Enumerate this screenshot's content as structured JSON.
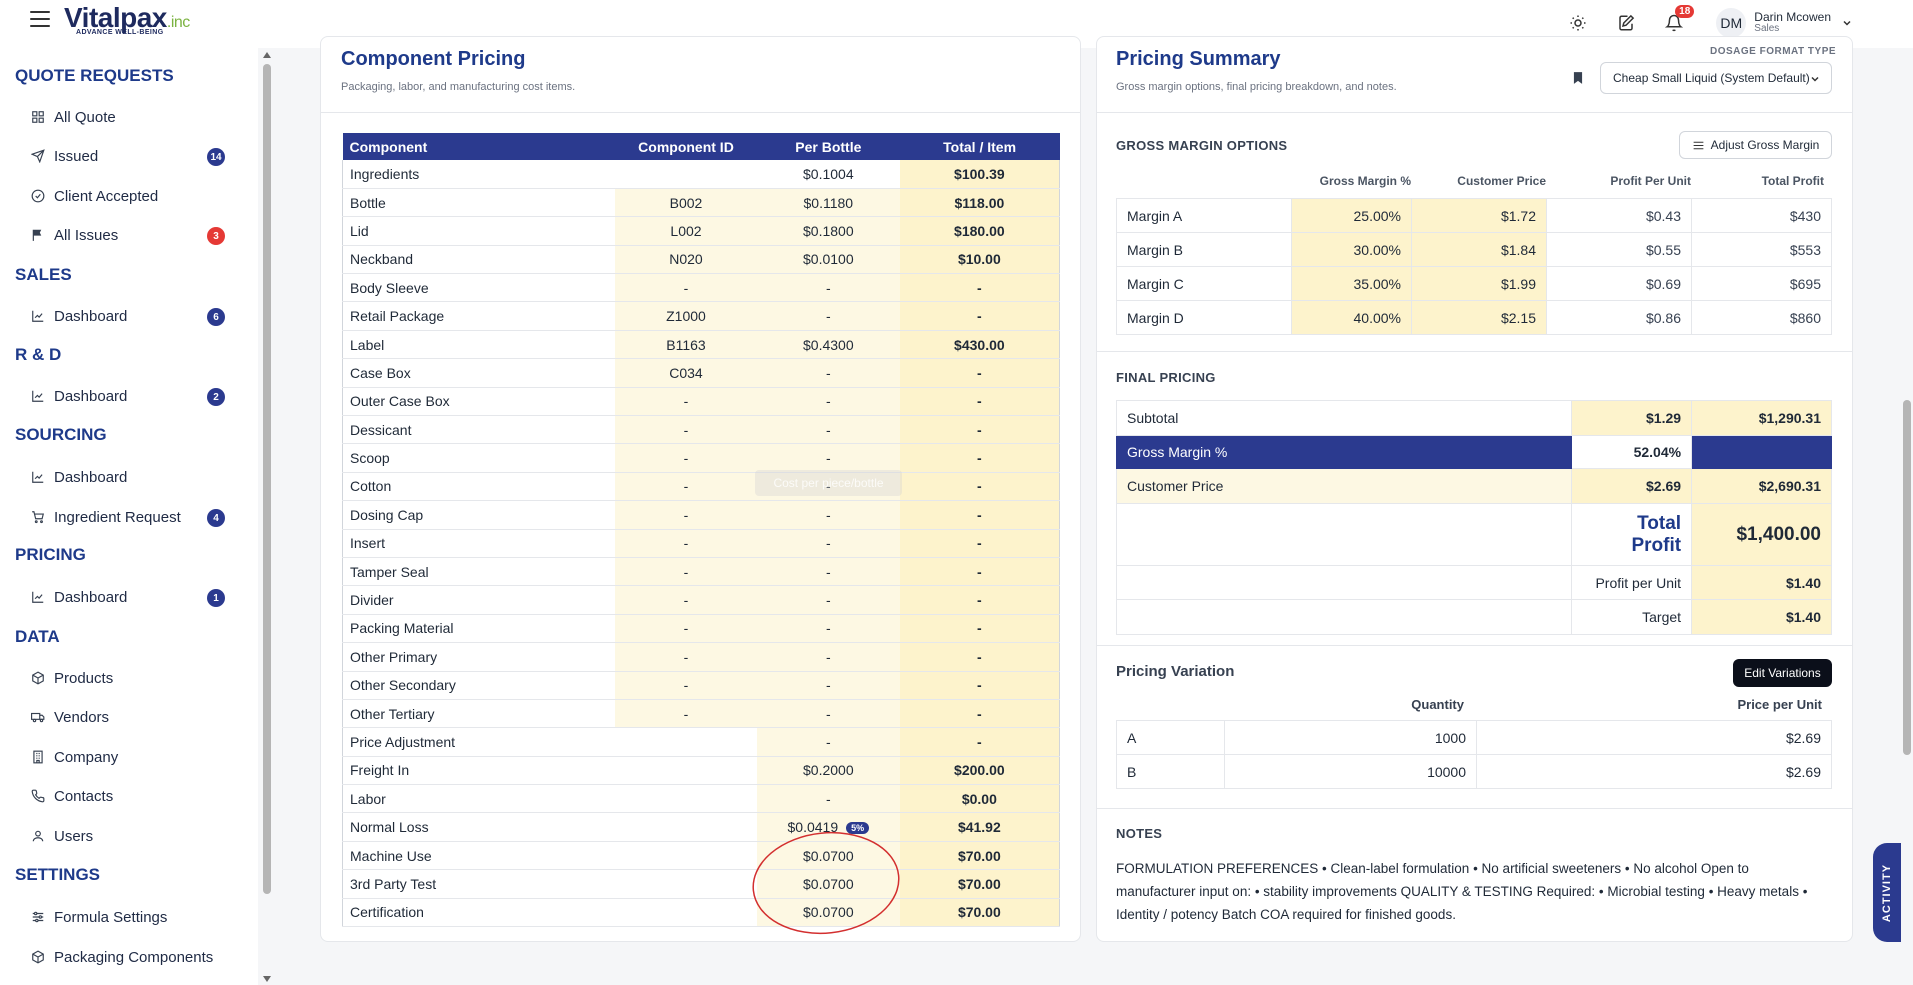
{
  "app": {
    "logo_name": "Vitalpax",
    "logo_suffix": ".inc",
    "logo_tagline": "ADVANCE WELL-BEING",
    "notifications_count": "18",
    "user_initials": "DM",
    "user_name": "Darin Mcowen",
    "user_role": "Sales"
  },
  "sidebar": {
    "sections": [
      {
        "title": "QUOTE REQUESTS",
        "items": [
          {
            "label": "All Quote",
            "icon": "grid-icon",
            "badge": ""
          },
          {
            "label": "Issued",
            "icon": "send-icon",
            "badge": "14"
          },
          {
            "label": "Client Accepted",
            "icon": "check-circle-icon",
            "badge": ""
          },
          {
            "label": "All Issues",
            "icon": "flag-icon",
            "badge": "3"
          }
        ]
      },
      {
        "title": "SALES",
        "items": [
          {
            "label": "Dashboard",
            "icon": "chart-icon",
            "badge": "6"
          }
        ]
      },
      {
        "title": "R & D",
        "items": [
          {
            "label": "Dashboard",
            "icon": "chart-icon",
            "badge": "2"
          }
        ]
      },
      {
        "title": "SOURCING",
        "items": [
          {
            "label": "Dashboard",
            "icon": "chart-icon",
            "badge": ""
          },
          {
            "label": "Ingredient Request",
            "icon": "cart-icon",
            "badge": "4"
          }
        ]
      },
      {
        "title": "PRICING",
        "items": [
          {
            "label": "Dashboard",
            "icon": "chart-icon",
            "badge": "1"
          }
        ]
      },
      {
        "title": "DATA",
        "items": [
          {
            "label": "Products",
            "icon": "box-icon",
            "badge": ""
          },
          {
            "label": "Vendors",
            "icon": "truck-icon",
            "badge": ""
          },
          {
            "label": "Company",
            "icon": "building-icon",
            "badge": ""
          },
          {
            "label": "Contacts",
            "icon": "phone-icon",
            "badge": ""
          },
          {
            "label": "Users",
            "icon": "user-icon",
            "badge": ""
          }
        ]
      },
      {
        "title": "SETTINGS",
        "items": [
          {
            "label": "Formula Settings",
            "icon": "sliders-icon",
            "badge": ""
          },
          {
            "label": "Packaging Components",
            "icon": "box-icon",
            "badge": ""
          }
        ]
      }
    ]
  },
  "component_pricing": {
    "title": "Component Pricing",
    "subtitle": "Packaging, labor, and manufacturing cost items.",
    "headers": [
      "Component",
      "Component ID",
      "Per Bottle",
      "Total / Item"
    ],
    "tooltip": "Cost per piece/bottle",
    "rows": [
      {
        "name": "Ingredients",
        "id": "",
        "per": "$0.1004",
        "total": "$100.39",
        "id_y": false,
        "per_y": false
      },
      {
        "name": "Bottle",
        "id": "B002",
        "per": "$0.1180",
        "total": "$118.00",
        "id_y": true,
        "per_y": true
      },
      {
        "name": "Lid",
        "id": "L002",
        "per": "$0.1800",
        "total": "$180.00",
        "id_y": true,
        "per_y": true
      },
      {
        "name": "Neckband",
        "id": "N020",
        "per": "$0.0100",
        "total": "$10.00",
        "id_y": true,
        "per_y": true
      },
      {
        "name": "Body Sleeve",
        "id": "-",
        "per": "-",
        "total": "-",
        "id_y": true,
        "per_y": true
      },
      {
        "name": "Retail Package",
        "id": "Z1000",
        "per": "-",
        "total": "-",
        "id_y": true,
        "per_y": true
      },
      {
        "name": "Label",
        "id": "B1163",
        "per": "$0.4300",
        "total": "$430.00",
        "id_y": true,
        "per_y": true
      },
      {
        "name": "Case Box",
        "id": "C034",
        "per": "-",
        "total": "-",
        "id_y": true,
        "per_y": true
      },
      {
        "name": "Outer Case Box",
        "id": "-",
        "per": "-",
        "total": "-",
        "id_y": true,
        "per_y": true
      },
      {
        "name": "Dessicant",
        "id": "-",
        "per": "-",
        "total": "-",
        "id_y": true,
        "per_y": true
      },
      {
        "name": "Scoop",
        "id": "-",
        "per": "-",
        "total": "-",
        "id_y": true,
        "per_y": true
      },
      {
        "name": "Cotton",
        "id": "-",
        "per": "-",
        "total": "-",
        "id_y": true,
        "per_y": true
      },
      {
        "name": "Dosing Cap",
        "id": "-",
        "per": "-",
        "total": "-",
        "id_y": true,
        "per_y": true
      },
      {
        "name": "Insert",
        "id": "-",
        "per": "-",
        "total": "-",
        "id_y": true,
        "per_y": true
      },
      {
        "name": "Tamper Seal",
        "id": "-",
        "per": "-",
        "total": "-",
        "id_y": true,
        "per_y": true
      },
      {
        "name": "Divider",
        "id": "-",
        "per": "-",
        "total": "-",
        "id_y": true,
        "per_y": true
      },
      {
        "name": "Packing Material",
        "id": "-",
        "per": "-",
        "total": "-",
        "id_y": true,
        "per_y": true
      },
      {
        "name": "Other Primary",
        "id": "-",
        "per": "-",
        "total": "-",
        "id_y": true,
        "per_y": true
      },
      {
        "name": "Other Secondary",
        "id": "-",
        "per": "-",
        "total": "-",
        "id_y": true,
        "per_y": true
      },
      {
        "name": "Other Tertiary",
        "id": "-",
        "per": "-",
        "total": "-",
        "id_y": true,
        "per_y": true
      },
      {
        "name": "Price Adjustment",
        "id": "",
        "per": "-",
        "total": "-",
        "id_y": false,
        "per_y": true
      },
      {
        "name": "Freight In",
        "id": "",
        "per": "$0.2000",
        "total": "$200.00",
        "id_y": false,
        "per_y": true
      },
      {
        "name": "Labor",
        "id": "",
        "per": "-",
        "total": "$0.00",
        "id_y": false,
        "per_y": true
      },
      {
        "name": "Normal Loss",
        "id": "",
        "per": "$0.0419",
        "total": "$41.92",
        "id_y": false,
        "per_y": true,
        "badge": "5%"
      },
      {
        "name": "Machine Use",
        "id": "",
        "per": "$0.0700",
        "total": "$70.00",
        "id_y": false,
        "per_y": true
      },
      {
        "name": "3rd Party Test",
        "id": "",
        "per": "$0.0700",
        "total": "$70.00",
        "id_y": false,
        "per_y": true
      },
      {
        "name": "Certification",
        "id": "",
        "per": "$0.0700",
        "total": "$70.00",
        "id_y": false,
        "per_y": true
      }
    ]
  },
  "pricing_summary": {
    "title": "Pricing Summary",
    "subtitle": "Gross margin options, final pricing breakdown, and notes.",
    "dosage_label": "DOSAGE FORMAT TYPE",
    "dosage_value": "Cheap Small Liquid (System Default)",
    "gm_title": "GROSS MARGIN OPTIONS",
    "gm_button": "Adjust Gross Margin",
    "gm_headers": [
      "Gross Margin %",
      "Customer Price",
      "Profit Per Unit",
      "Total Profit"
    ],
    "gm_rows": [
      {
        "name": "Margin A",
        "pct": "25.00%",
        "price": "$1.72",
        "ppu": "$0.43",
        "total": "$430"
      },
      {
        "name": "Margin B",
        "pct": "30.00%",
        "price": "$1.84",
        "ppu": "$0.55",
        "total": "$553"
      },
      {
        "name": "Margin C",
        "pct": "35.00%",
        "price": "$1.99",
        "ppu": "$0.69",
        "total": "$695"
      },
      {
        "name": "Margin D",
        "pct": "40.00%",
        "price": "$2.15",
        "ppu": "$0.86",
        "total": "$860"
      }
    ],
    "fp_title": "FINAL PRICING",
    "fp": {
      "subtotal_label": "Subtotal",
      "subtotal_unit": "$1.29",
      "subtotal_total": "$1,290.31",
      "gm_label": "Gross Margin %",
      "gm_value": "52.04%",
      "cp_label": "Customer Price",
      "cp_unit": "$2.69",
      "cp_total": "$2,690.31",
      "tp_label": "Total Profit",
      "tp_value": "$1,400.00",
      "ppu_label": "Profit per Unit",
      "ppu_value": "$1.40",
      "target_label": "Target",
      "target_value": "$1.40"
    },
    "pv_title": "Pricing Variation",
    "pv_button": "Edit Variations",
    "pv_headers": [
      "Quantity",
      "Price per Unit"
    ],
    "pv_rows": [
      {
        "name": "A",
        "qty": "1000",
        "price": "$2.69"
      },
      {
        "name": "B",
        "qty": "10000",
        "price": "$2.69"
      }
    ],
    "notes_title": "NOTES",
    "notes_text": "FORMULATION PREFERENCES • Clean-label formulation • No artificial sweeteners • No alcohol Open to manufacturer input on: • stability improvements QUALITY & TESTING Required: • Microbial testing • Heavy metals • Identity / potency Batch COA required for finished goods."
  },
  "activity_tab": "ACTIVITY"
}
